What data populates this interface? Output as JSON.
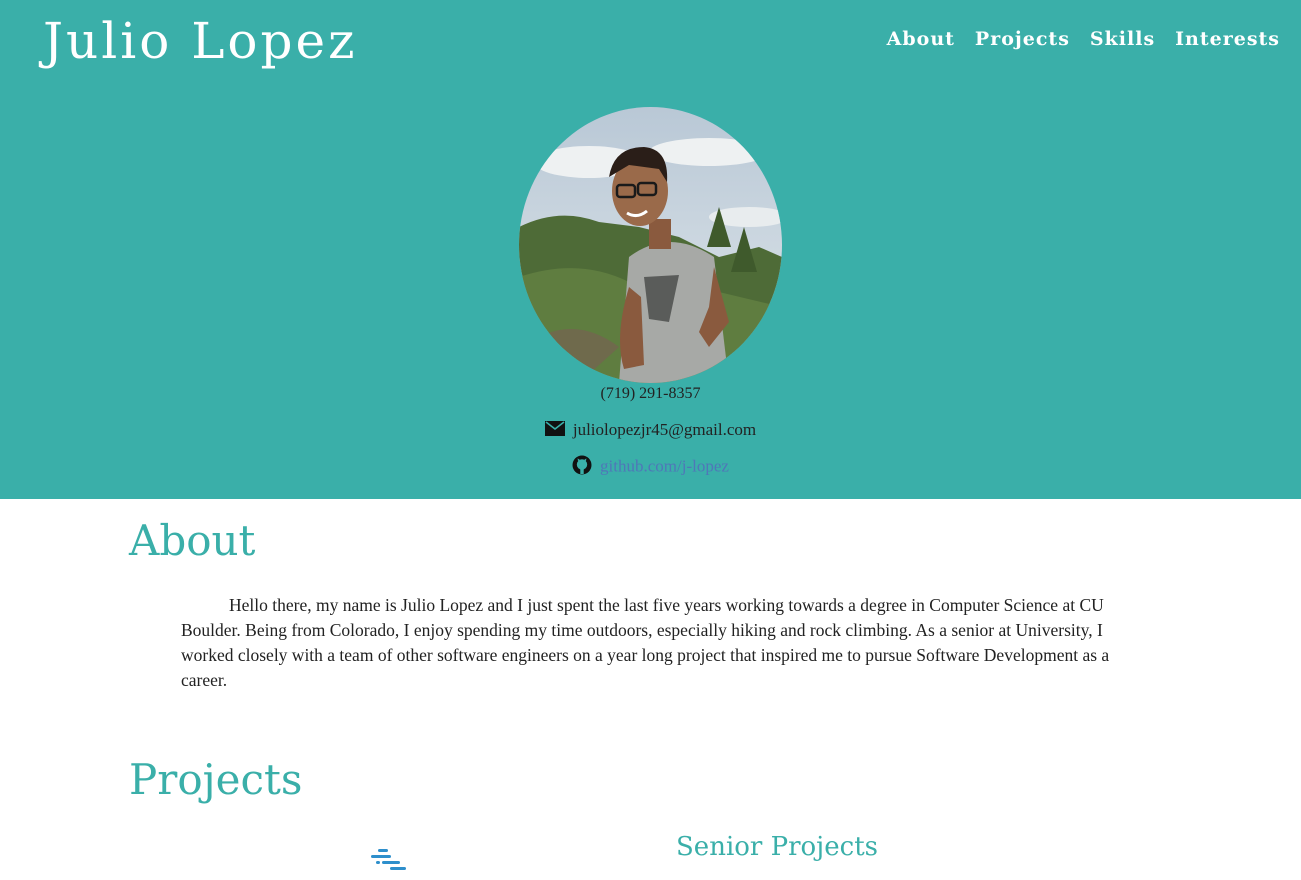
{
  "header": {
    "site_title": "Julio Lopez",
    "background_color": "#3aafa9",
    "nav": [
      {
        "label": "About"
      },
      {
        "label": "Projects"
      },
      {
        "label": "Skills"
      },
      {
        "label": "Interests"
      }
    ]
  },
  "profile": {
    "photo_alt": "Julio Lopez",
    "phone": "(719) 291-8357",
    "email": "juliolopezjr45@gmail.com",
    "email_icon": "envelope-icon",
    "github": "github.com/j-lopez",
    "github_icon": "github-icon"
  },
  "about": {
    "title": "About",
    "text": "Hello there, my name is Julio Lopez and I just spent the last five years working towards a degree in Computer Science at CU Boulder. Being from Colorado, I enjoy spending my time outdoors, especially hiking and rock climbing. As a senior at University, I worked closely with a team of other software engineers on a year long project that inspired me to pursue Software Development as a career."
  },
  "projects": {
    "title": "Projects",
    "items": [
      {
        "title": "Senior Projects",
        "logo_icon": "project-logo-icon"
      }
    ]
  },
  "colors": {
    "accent": "#3aafa9",
    "link": "#4f77b8",
    "text": "#222222"
  }
}
